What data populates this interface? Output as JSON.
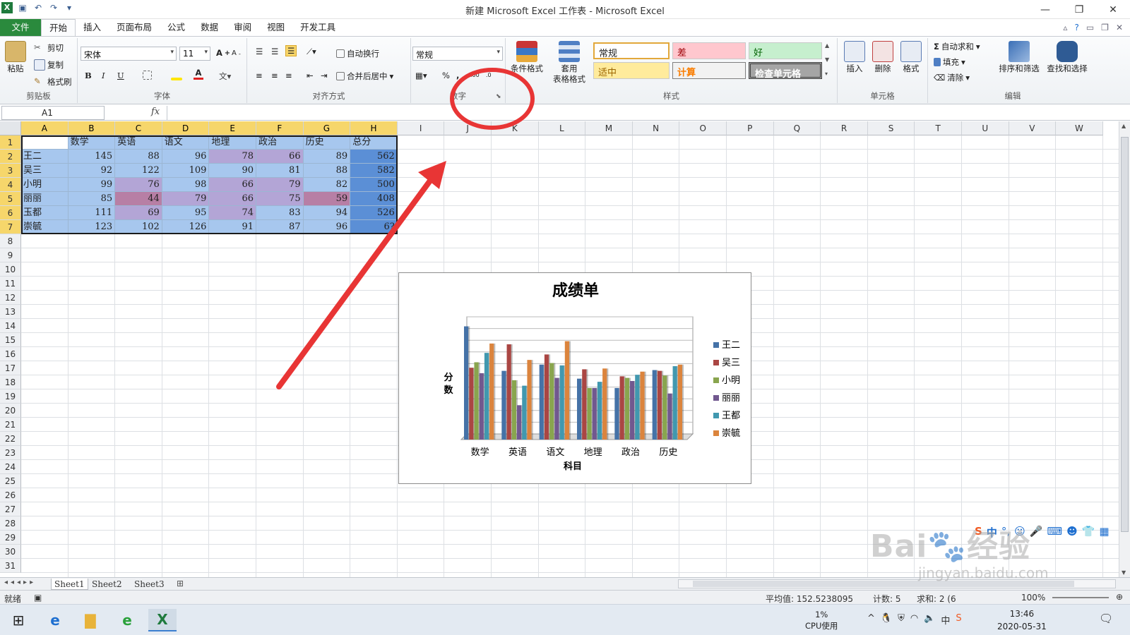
{
  "window": {
    "title": "新建 Microsoft Excel 工作表 - Microsoft Excel"
  },
  "tabs": [
    "文件",
    "开始",
    "插入",
    "页面布局",
    "公式",
    "数据",
    "审阅",
    "视图",
    "开发工具"
  ],
  "ribbon": {
    "clipboard": {
      "paste": "粘贴",
      "cut": "剪切",
      "copy": "复制",
      "format_painter": "格式刷",
      "label": "剪贴板"
    },
    "font": {
      "name": "宋体",
      "size": "11",
      "label": "字体",
      "bold": "B",
      "italic": "I",
      "underline": "U",
      "font_color_icon": "A"
    },
    "alignment": {
      "wrap": "自动换行",
      "merge": "合并后居中",
      "label": "对齐方式"
    },
    "number": {
      "format": "常规",
      "label": "数字",
      "percent": "%",
      "comma": ","
    },
    "styles": {
      "conditional": "条件格式",
      "table_line1": "套用",
      "table_line2": "表格格式",
      "normal": "常规",
      "bad": "差",
      "good": "好",
      "neutral": "适中",
      "calculation": "计算",
      "check_cell": "检查单元格",
      "label": "样式"
    },
    "cells": {
      "insert": "插入",
      "delete": "删除",
      "format": "格式",
      "label": "单元格"
    },
    "editing": {
      "autosum": "自动求和",
      "fill": "填充",
      "clear": "清除",
      "sort": "排序和筛选",
      "find": "查找和选择",
      "label": "编辑"
    }
  },
  "formula_bar": {
    "name_box": "A1",
    "fx": "fx"
  },
  "columns": [
    "A",
    "B",
    "C",
    "D",
    "E",
    "F",
    "G",
    "H",
    "I",
    "J",
    "K",
    "L",
    "M",
    "N",
    "O",
    "P",
    "Q",
    "R",
    "S",
    "T",
    "U",
    "V",
    "W"
  ],
  "rows": [
    "1",
    "2",
    "3",
    "4",
    "5",
    "6",
    "7",
    "8",
    "9",
    "10",
    "11",
    "12",
    "13",
    "14",
    "15",
    "16",
    "17",
    "18",
    "19",
    "20",
    "21",
    "22",
    "23",
    "24",
    "25",
    "26",
    "27",
    "28",
    "29",
    "30",
    "31"
  ],
  "table": {
    "headers": [
      "",
      "数学",
      "英语",
      "语文",
      "地理",
      "政治",
      "历史",
      "总分"
    ],
    "data": [
      [
        "王二",
        "145",
        "88",
        "96",
        "78",
        "66",
        "89",
        "562"
      ],
      [
        "吴三",
        "92",
        "122",
        "109",
        "90",
        "81",
        "88",
        "582"
      ],
      [
        "小明",
        "99",
        "76",
        "98",
        "66",
        "79",
        "82",
        "500"
      ],
      [
        "丽丽",
        "85",
        "44",
        "79",
        "66",
        "75",
        "59",
        "408"
      ],
      [
        "玉都",
        "111",
        "69",
        "95",
        "74",
        "83",
        "94",
        "526"
      ],
      [
        "崇毓",
        "123",
        "102",
        "126",
        "91",
        "87",
        "96",
        "6?"
      ]
    ]
  },
  "chart_data": {
    "type": "bar",
    "title": "成绩单",
    "xlabel": "科目",
    "ylabel": "分数",
    "categories": [
      "数学",
      "英语",
      "语文",
      "地理",
      "政治",
      "历史"
    ],
    "series": [
      {
        "name": "王二",
        "color": "#4572a7",
        "values": [
          145,
          88,
          96,
          78,
          66,
          89
        ]
      },
      {
        "name": "吴三",
        "color": "#aa4643",
        "values": [
          92,
          122,
          109,
          90,
          81,
          88
        ]
      },
      {
        "name": "小明",
        "color": "#89a54e",
        "values": [
          99,
          76,
          98,
          66,
          79,
          82
        ]
      },
      {
        "name": "丽丽",
        "color": "#71588f",
        "values": [
          85,
          44,
          79,
          66,
          75,
          59
        ]
      },
      {
        "name": "王都",
        "color": "#4198af",
        "values": [
          111,
          69,
          95,
          74,
          83,
          94
        ]
      },
      {
        "name": "崇毓",
        "color": "#db843d",
        "values": [
          123,
          102,
          126,
          91,
          87,
          96
        ]
      }
    ],
    "ylim": [
      0,
      150
    ],
    "legend_position": "right",
    "grid": true
  },
  "sheets": [
    "Sheet1",
    "Sheet2",
    "Sheet3"
  ],
  "status": {
    "ready": "就绪",
    "average": "平均值: 152.5238095",
    "count": "计数: 5",
    "sum": "求和: 2 (6",
    "zoom": "100%"
  },
  "taskbar": {
    "cpu_value": "1%",
    "cpu_label": "CPU使用",
    "time": "13:46",
    "date": "2020-05-31",
    "ime": "中"
  },
  "watermark": {
    "brand": "Bai",
    "brand2": "经验",
    "url": "jingyan.baidu.com"
  }
}
